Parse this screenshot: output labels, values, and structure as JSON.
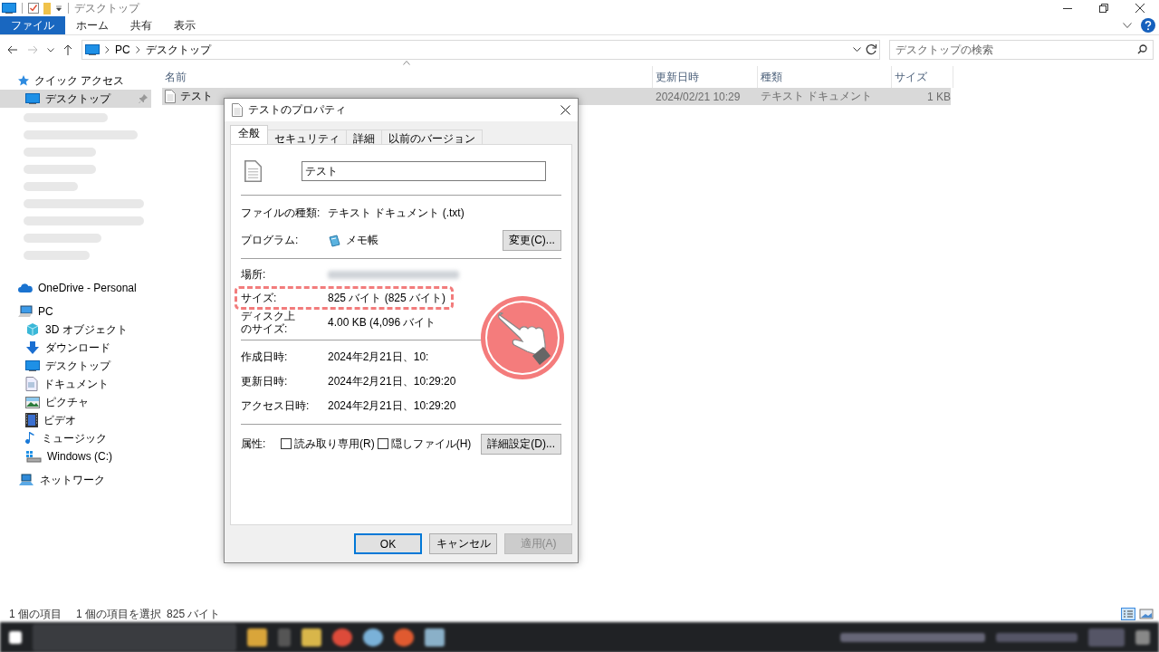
{
  "window": {
    "title": "デスクトップ"
  },
  "ribbon_tabs": [
    {
      "label": "ファイル",
      "kind": "file",
      "selected": false
    },
    {
      "label": "ホーム",
      "kind": "tab",
      "selected": false
    },
    {
      "label": "共有",
      "kind": "tab",
      "selected": false
    },
    {
      "label": "表示",
      "kind": "tab",
      "selected": false
    }
  ],
  "address_bar": {
    "path": [
      "PC",
      "デスクトップ"
    ]
  },
  "search": {
    "placeholder": "デスクトップの検索"
  },
  "navigation": {
    "quick_access": {
      "label": "クイック アクセス",
      "items": [
        {
          "label": "デスクトップ",
          "kind": "desktop",
          "selected": true
        }
      ]
    },
    "locations": [
      {
        "label": "OneDrive - Personal",
        "kind": "cloud"
      },
      {
        "label": "PC",
        "kind": "pc",
        "children": [
          {
            "label": "3D オブジェクト",
            "kind": "cube"
          },
          {
            "label": "ダウンロード",
            "kind": "download"
          },
          {
            "label": "デスクトップ",
            "kind": "desktop"
          },
          {
            "label": "ドキュメント",
            "kind": "document"
          },
          {
            "label": "ピクチャ",
            "kind": "picture"
          },
          {
            "label": "ビデオ",
            "kind": "video"
          },
          {
            "label": "ミュージック",
            "kind": "music"
          },
          {
            "label": "Windows (C:)",
            "kind": "drive"
          }
        ]
      },
      {
        "label": "ネットワーク",
        "kind": "network"
      }
    ]
  },
  "file_list": {
    "columns": [
      "名前",
      "更新日時",
      "種類",
      "サイズ"
    ],
    "rows": [
      {
        "name": "テスト",
        "modified": "2024/02/21 10:29",
        "type": "テキスト ドキュメント",
        "size": "1 KB",
        "selected": true
      }
    ]
  },
  "status_bar": {
    "item_count": "1 個の項目",
    "selection": "1 個の項目を選択",
    "selection_size": "825 バイト"
  },
  "dialog": {
    "title": "テストのプロパティ",
    "tabs": [
      {
        "label": "全般",
        "selected": true
      },
      {
        "label": "セキュリティ",
        "selected": false
      },
      {
        "label": "詳細",
        "selected": false
      },
      {
        "label": "以前のバージョン",
        "selected": false
      }
    ],
    "file_name": "テスト",
    "type_label": "ファイルの種類:",
    "type_value": "テキスト ドキュメント (.txt)",
    "program_label": "プログラム:",
    "program_value": "メモ帳",
    "change_button": "変更(C)...",
    "location_label": "場所:",
    "size_rows": [
      {
        "label": "サイズ:",
        "value": "825 バイト (825 バイト)",
        "highlighted": true
      },
      {
        "label": "ディスク上のサイズ:",
        "value": "4.00 KB (4,096 バイト",
        "highlighted": false
      }
    ],
    "date_rows": [
      {
        "label": "作成日時:",
        "value": "2024年2月21日、10:"
      },
      {
        "label": "更新日時:",
        "value": "2024年2月21日、10:29:20"
      },
      {
        "label": "アクセス日時:",
        "value": "2024年2月21日、10:29:20"
      }
    ],
    "attributes_label": "属性:",
    "attributes": [
      {
        "label": "読み取り専用(R)",
        "checked": false
      },
      {
        "label": "隠しファイル(H)",
        "checked": false
      }
    ],
    "advanced_button": "詳細設定(D)...",
    "buttons": [
      {
        "label": "OK",
        "kind": "default",
        "disabled": false
      },
      {
        "label": "キャンセル",
        "kind": "normal",
        "disabled": false
      },
      {
        "label": "適用(A)",
        "kind": "normal",
        "disabled": true
      }
    ]
  }
}
